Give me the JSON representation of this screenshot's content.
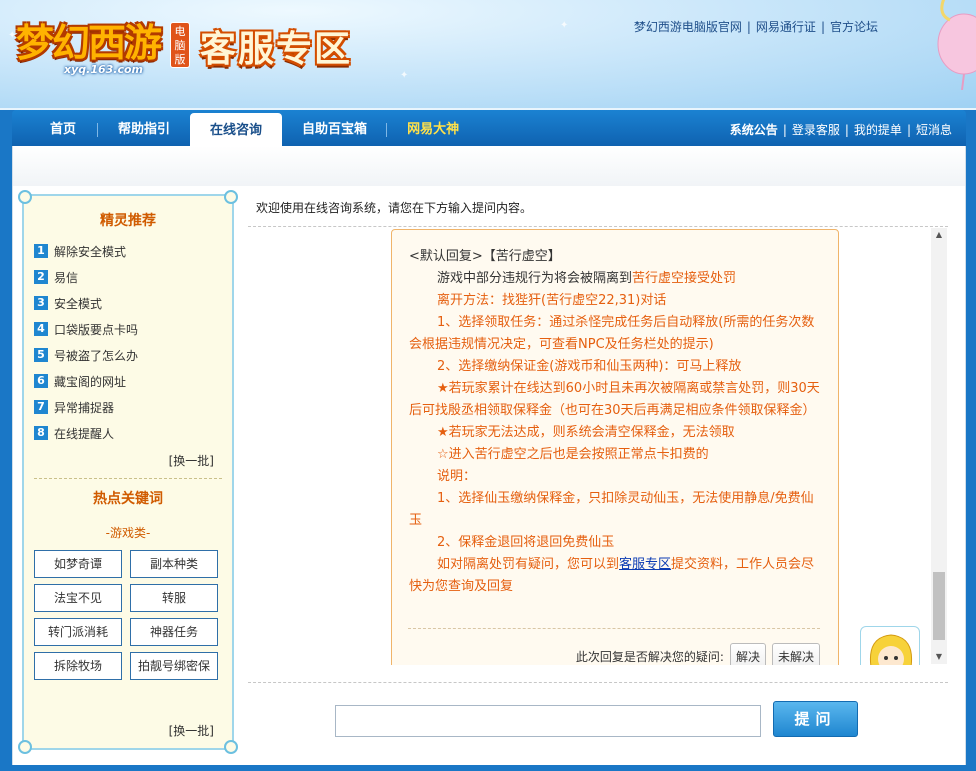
{
  "header": {
    "logo_game": "梦幻西游",
    "logo_badge": "电脑版",
    "logo_url": "xyq.163.com",
    "title": "客服专区",
    "links": [
      "梦幻西游电脑版官网",
      "网易通行证",
      "官方论坛"
    ]
  },
  "nav": {
    "items": [
      {
        "label": "首页"
      },
      {
        "label": "帮助指引"
      },
      {
        "label": "在线咨询",
        "active": true
      },
      {
        "label": "自助百宝箱"
      },
      {
        "label": "网易大神",
        "highlight": true
      }
    ],
    "right": [
      "系统公告",
      "登录客服",
      "我的提单",
      "短消息"
    ]
  },
  "sidebar": {
    "recommend_title": "精灵推荐",
    "recommend": [
      "解除安全模式",
      "易信",
      "安全模式",
      "口袋版要点卡吗",
      "号被盗了怎么办",
      "藏宝阁的网址",
      "异常捕捉器",
      "在线提醒人"
    ],
    "more_label": "[换一批]",
    "hot_title": "热点关键词",
    "category": "-游戏类-",
    "keywords": [
      "如梦奇谭",
      "副本种类",
      "法宝不见",
      "转服",
      "转门派消耗",
      "神器任务",
      "拆除牧场",
      "拍靓号绑密保"
    ],
    "more_label2": "[换一批]"
  },
  "main": {
    "welcome": "欢迎使用在线咨询系统，请您在下方输入提问内容。",
    "reply": {
      "header": "<默认回复>【苦行虚空】",
      "l1a": "游戏中部分违规行为将会被隔离到",
      "l1b": "苦行虚空接受处罚",
      "l2": "离开方法：找狴犴(苦行虚空22,31)对话",
      "l3": "1、选择领取任务：通过杀怪完成任务后自动释放(所需的任务次数会根据违规情况决定，可查看NPC及任务栏处的提示)",
      "l4": "2、选择缴纳保证金(游戏币和仙玉两种)：可马上释放",
      "l5": "★若玩家累计在线达到60小时且未再次被隔离或禁言处罚，则30天后可找殷丞相领取保释金（也可在30天后再满足相应条件领取保释金）",
      "l6": "★若玩家无法达成，则系统会清空保释金，无法领取",
      "l7": "☆进入苦行虚空之后也是会按照正常点卡扣费的",
      "l8": "说明：",
      "l9": "1、选择仙玉缴纳保释金，只扣除灵动仙玉，无法使用静息/免费仙玉",
      "l10": "2、保释金退回将退回免费仙玉",
      "l11a": "如对隔离处罚有疑问，您可以到",
      "l11link": "客服专区",
      "l11b": "提交资料，工作人员会尽快为您查询及回复"
    },
    "feedback_q": "此次回复是否解决您的疑问:",
    "feedback_yes": "解决",
    "feedback_no": "未解决",
    "ask_placeholder": "",
    "ask_button": "提问"
  }
}
